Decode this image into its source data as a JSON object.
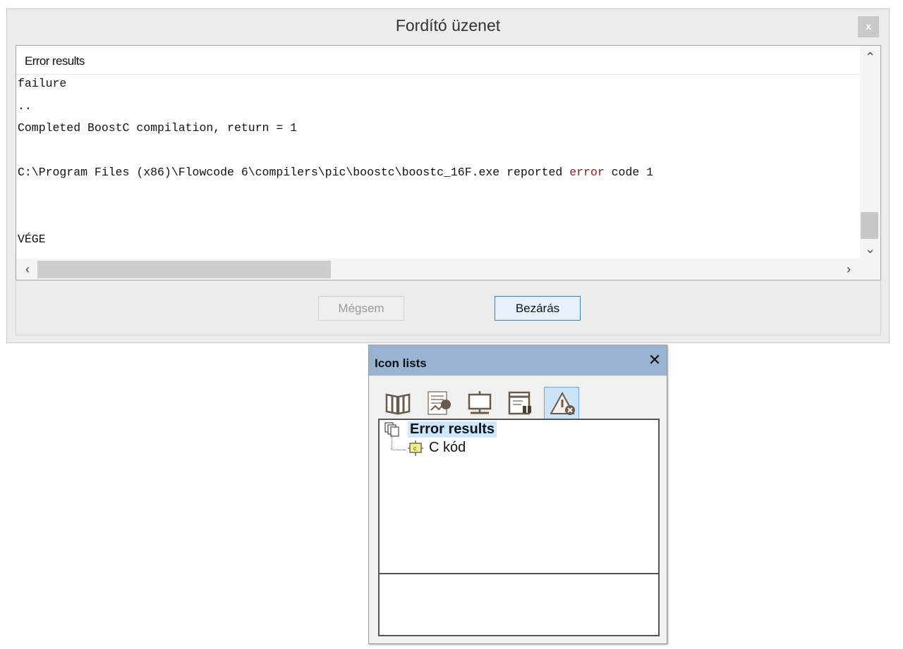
{
  "dialog": {
    "title": "Fordító üzenet",
    "close_label": "x",
    "panel_title": "Error results",
    "log": [
      {
        "text": "failure"
      },
      {
        "text": ".."
      },
      {
        "text": "Completed BoostC compilation, return = 1"
      },
      {
        "text": "C:\\Program Files (x86)\\Flowcode 6\\compilers\\pic\\boostc\\boostc_16F.exe reported ",
        "error_word": "error",
        "tail": " code 1"
      },
      {
        "text": "VÉGE"
      }
    ],
    "cancel_label": "Mégsem",
    "close_button_label": "Bezárás",
    "error_color": "#8b1a1a"
  },
  "icon_lists": {
    "title": "Icon lists",
    "close_label": "✕",
    "toolbar": [
      "book-icon",
      "report-icon",
      "display-board-icon",
      "window-search-icon",
      "warning-error-icon"
    ],
    "tree": {
      "root_label": "Error results",
      "child_label": "C kód"
    }
  }
}
